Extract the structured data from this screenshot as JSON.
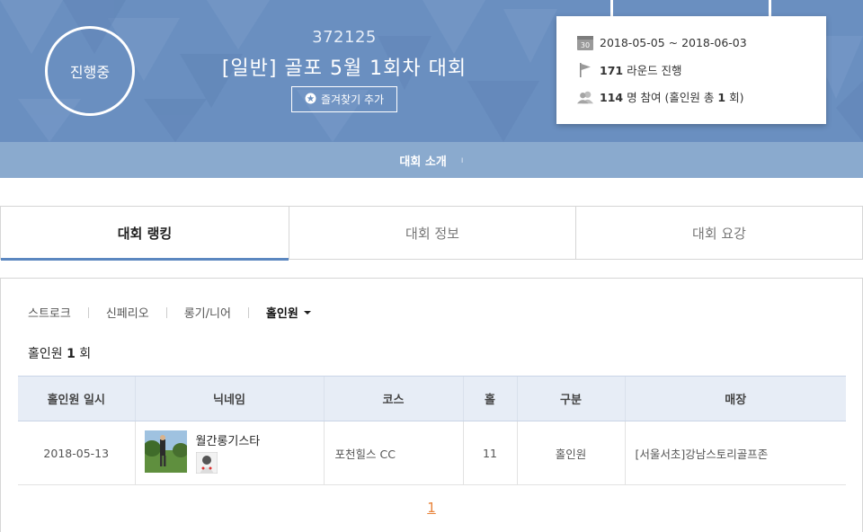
{
  "header": {
    "status": "진행중",
    "contest_id": "372125",
    "title": "[일반] 골포 5월 1회차 대회",
    "favorite_label": "즐겨찾기 추가",
    "calendar_day": "30",
    "date_range": "2018-05-05 ~ 2018-06-03",
    "rounds_count": "171",
    "rounds_text": "라운드 진행",
    "participants_count": "114",
    "participants_text": "명 참여 (홀인원 총",
    "hole_in_one_total": "1",
    "hole_in_one_suffix": "회)"
  },
  "intro_bar": {
    "label": "대회 소개",
    "separator": "ı"
  },
  "tabs": [
    {
      "label": "대회 랭킹",
      "active": true
    },
    {
      "label": "대회 정보",
      "active": false
    },
    {
      "label": "대회 요강",
      "active": false
    }
  ],
  "subtabs": [
    {
      "label": "스트로크"
    },
    {
      "label": "신페리오"
    },
    {
      "label": "롱기/니어"
    },
    {
      "label": "홀인원"
    }
  ],
  "summary": {
    "label": "홀인원",
    "count": "1",
    "unit": "회"
  },
  "table": {
    "headers": [
      "홀인원 일시",
      "닉네임",
      "코스",
      "홀",
      "구분",
      "매장"
    ],
    "rows": [
      {
        "date": "2018-05-13",
        "nickname": "월간롱기스타",
        "course": "포천힐스 CC",
        "hole": "11",
        "type": "홀인원",
        "store": "[서울서초]강남스토리골프존"
      }
    ]
  },
  "pagination": {
    "current": "1"
  },
  "colors": {
    "banner": "#6a8fc0",
    "intro_bar": "#8aaace",
    "tab_active_underline": "#5b87c0",
    "table_header_bg": "#e7edf6",
    "page_link": "#e8833a"
  },
  "icons": [
    "star-icon",
    "calendar-icon",
    "flag-icon",
    "users-icon",
    "caret-down-icon"
  ]
}
